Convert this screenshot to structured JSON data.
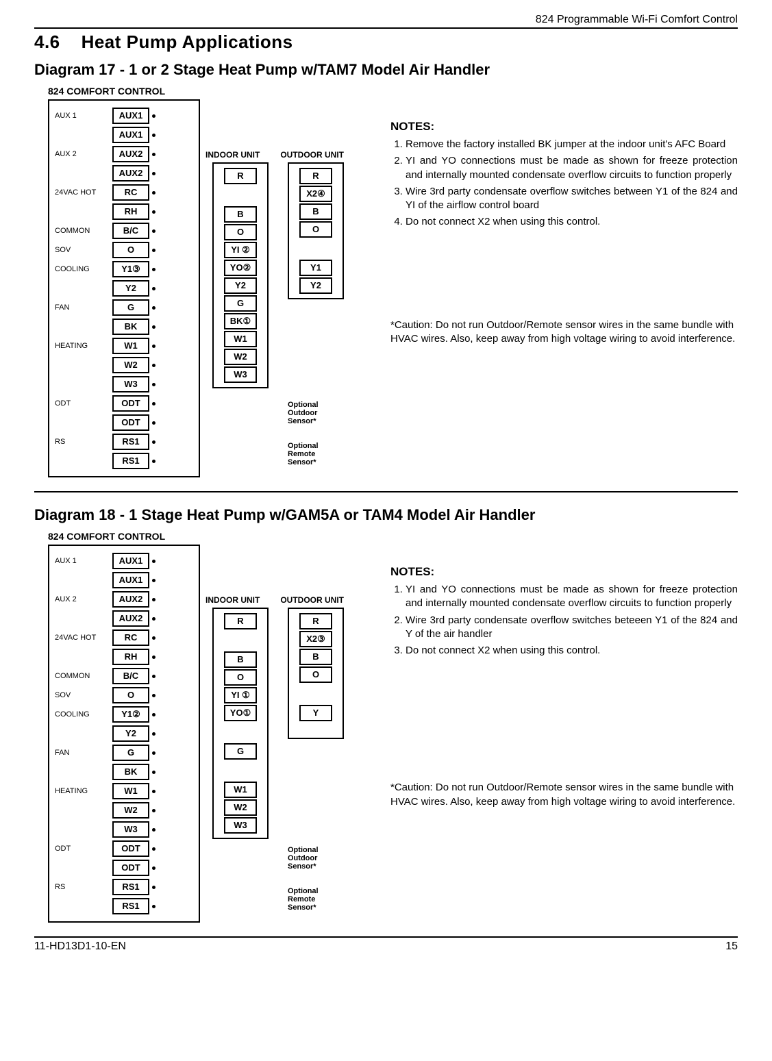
{
  "header": {
    "product": "824 Programmable Wi-Fi Comfort Control"
  },
  "section": {
    "number": "4.6",
    "title": "Heat Pump Applications"
  },
  "footer": {
    "doc": "11-HD13D1-10-EN",
    "page": "15"
  },
  "diagram17": {
    "title": "Diagram 17 - 1 or 2 Stage Heat Pump w/TAM7 Model Air Handler",
    "control_title": "824 COMFORT CONTROL",
    "indoor_label": "INDOOR UNIT",
    "outdoor_label": "OUTDOOR UNIT",
    "control_rows": [
      {
        "label": "AUX 1",
        "terms": [
          "AUX1",
          "AUX1"
        ]
      },
      {
        "label": "AUX 2",
        "terms": [
          "AUX2",
          "AUX2"
        ]
      },
      {
        "label": "24VAC HOT",
        "terms": [
          "RC",
          "RH"
        ]
      },
      {
        "label": "COMMON",
        "terms": [
          "B/C"
        ]
      },
      {
        "label": "SOV",
        "terms": [
          "O"
        ]
      },
      {
        "label": "COOLING",
        "terms": [
          "Y1③",
          "Y2"
        ]
      },
      {
        "label": "FAN",
        "terms": [
          "G",
          "BK"
        ]
      },
      {
        "label": "HEATING",
        "terms": [
          "W1",
          "W2",
          "W3"
        ]
      },
      {
        "label": "ODT",
        "terms": [
          "ODT",
          "ODT"
        ]
      },
      {
        "label": "RS",
        "terms": [
          "RS1",
          "RS1"
        ]
      }
    ],
    "indoor_terms": [
      "R",
      "",
      "B",
      "O",
      "YI ②",
      "YO②",
      "Y2",
      "G",
      "BK①",
      "W1",
      "W2",
      "W3"
    ],
    "outdoor_terms": [
      "R",
      "X2④",
      "B",
      "O",
      "",
      "Y1",
      "Y2"
    ],
    "optional1_l1": "Optional",
    "optional1_l2": "Outdoor",
    "optional1_l3": "Sensor*",
    "optional2_l1": "Optional",
    "optional2_l2": "Remote",
    "optional2_l3": "Sensor*",
    "notes_heading": "NOTES:",
    "notes": [
      "Remove the factory installed BK jumper at the indoor unit's AFC Board",
      "YI and YO connections must be made as shown for freeze protection and internally mounted condensate overflow circuits to function properly",
      "Wire 3rd party condensate overflow switches between Y1 of the 824 and YI of the airflow control board",
      "Do not connect X2 when using this control."
    ],
    "caution": "*Caution: Do not run Outdoor/Remote sensor wires in the same bundle with HVAC wires. Also, keep away from high voltage wiring to avoid interference."
  },
  "diagram18": {
    "title": "Diagram 18 - 1 Stage Heat Pump w/GAM5A or TAM4 Model Air Handler",
    "control_title": "824 COMFORT CONTROL",
    "indoor_label": "INDOOR UNIT",
    "outdoor_label": "OUTDOOR UNIT",
    "control_rows": [
      {
        "label": "AUX 1",
        "terms": [
          "AUX1",
          "AUX1"
        ]
      },
      {
        "label": "AUX 2",
        "terms": [
          "AUX2",
          "AUX2"
        ]
      },
      {
        "label": "24VAC HOT",
        "terms": [
          "RC",
          "RH"
        ]
      },
      {
        "label": "COMMON",
        "terms": [
          "B/C"
        ]
      },
      {
        "label": "SOV",
        "terms": [
          "O"
        ]
      },
      {
        "label": "COOLING",
        "terms": [
          "Y1②",
          "Y2"
        ]
      },
      {
        "label": "FAN",
        "terms": [
          "G",
          "BK"
        ]
      },
      {
        "label": "HEATING",
        "terms": [
          "W1",
          "W2",
          "W3"
        ]
      },
      {
        "label": "ODT",
        "terms": [
          "ODT",
          "ODT"
        ]
      },
      {
        "label": "RS",
        "terms": [
          "RS1",
          "RS1"
        ]
      }
    ],
    "indoor_terms": [
      "R",
      "",
      "B",
      "O",
      "YI ①",
      "YO①",
      "",
      "G",
      "",
      "W1",
      "W2",
      "W3"
    ],
    "outdoor_terms": [
      "R",
      "X2③",
      "B",
      "O",
      "",
      "Y"
    ],
    "optional1_l1": "Optional",
    "optional1_l2": "Outdoor",
    "optional1_l3": "Sensor*",
    "optional2_l1": "Optional",
    "optional2_l2": "Remote",
    "optional2_l3": "Sensor*",
    "notes_heading": "NOTES:",
    "notes": [
      "YI and YO connections must be made as shown for freeze protection and internally mounted condensate overflow circuits to function properly",
      "Wire 3rd party condensate overflow switches beteeen Y1 of the 824 and Y of the air handler",
      "Do not connect X2 when using this control."
    ],
    "caution": "*Caution: Do not run Outdoor/Remote sensor wires in the same bundle with HVAC wires. Also, keep away from high voltage wiring to avoid interference."
  }
}
